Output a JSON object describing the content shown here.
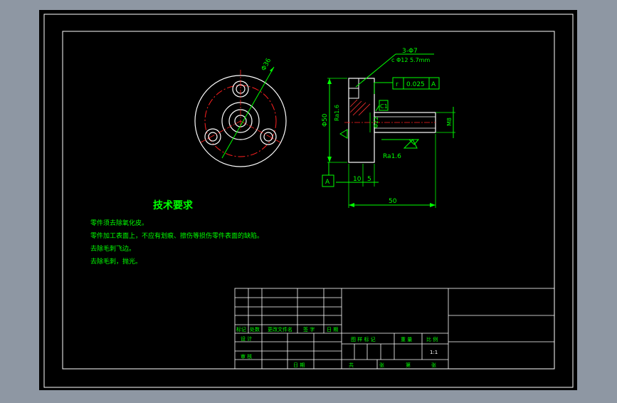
{
  "drawing": {
    "tech_req": {
      "title": "技术要求",
      "lines": [
        "零件须去除氧化皮。",
        "零件加工表面上，不应有划痕、擦伤等损伤零件表面的缺陷。",
        "去除毛刺飞边。",
        "去除毛刺，抛光。"
      ]
    },
    "front_view": {
      "dim_bolt_circle": "Φ36"
    },
    "section_view": {
      "hole_spec_1": "3-Φ7",
      "hole_spec_2": "c Φ12 5.7mm",
      "tol_symbol": "r",
      "tol_value": "0.025",
      "tol_datum": "A",
      "chamfer": "C1",
      "dia_flange": "Φ50",
      "dia_shaft": "Φ22",
      "thread": "M8",
      "rough_1": "Ra1.6",
      "rough_2": "Ra1.6",
      "datum_label": "A",
      "dim_10": "10",
      "dim_5": "5",
      "dim_50": "50"
    },
    "title_block": {
      "rev_headers": [
        "标记",
        "处数",
        "更改文件名",
        "签 字",
        "日 期"
      ],
      "design": "设 计",
      "audit": "审 核",
      "date": "日 期",
      "stage_mark": "图 样 标 记",
      "weight": "重 量",
      "scale": "比 例",
      "scale_value": "1:1",
      "total": "共",
      "sheet_unit_1": "张",
      "sheet": "第",
      "sheet_unit_2": "张"
    }
  }
}
